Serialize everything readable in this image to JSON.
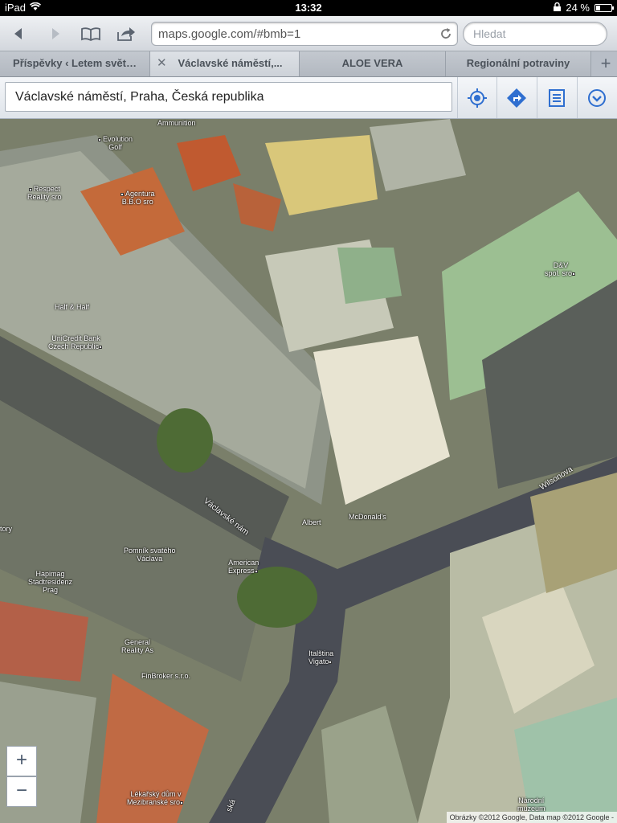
{
  "status_bar": {
    "device": "iPad",
    "time": "13:32",
    "battery": "24 %",
    "battery_level": 0.24,
    "icons": [
      "wifi-icon",
      "lock-icon",
      "battery-icon"
    ]
  },
  "browser": {
    "url": "maps.google.com/#bmb=1",
    "search_placeholder": "Hledat",
    "tabs": [
      {
        "label": "Příspěvky ‹ Letem svět…",
        "active": false
      },
      {
        "label": "Václavské náměstí,...",
        "active": true
      },
      {
        "label": "ALOE VERA",
        "active": false
      },
      {
        "label": "Regionální potraviny",
        "active": false
      }
    ],
    "toolbar_icons": [
      "back-icon",
      "forward-icon",
      "bookmarks-icon",
      "share-icon"
    ]
  },
  "maps": {
    "search_value": "Václavské náměstí, Praha, Česká republika",
    "buttons": [
      "my-location-icon",
      "directions-icon",
      "list-icon",
      "menu-icon"
    ],
    "zoom_in": "+",
    "zoom_out": "−",
    "copyright": "Obrázky ©2012 Google, Data map ©2012 Google -",
    "pois": [
      {
        "label": "Ammunition"
      },
      {
        "label": "Evolution\nGolf"
      },
      {
        "label": "Respect\nReality sro"
      },
      {
        "label": "Agentura\nB.B.O sro"
      },
      {
        "label": "Half & Half"
      },
      {
        "label": "UniCredit Bank\nCzech Republic"
      },
      {
        "label": "D&V\nspol. sro"
      },
      {
        "label": "Albert"
      },
      {
        "label": "McDonald's"
      },
      {
        "label": "Pomník svatého\nVáclava"
      },
      {
        "label": "American\nExpress"
      },
      {
        "label": "Hapimag\nStadtresidenz\nPrag"
      },
      {
        "label": "General\nReality As"
      },
      {
        "label": "FinBroker s.r.o."
      },
      {
        "label": "Italština\nVigato"
      },
      {
        "label": "Lékařský dům v\nMezibranské sro"
      },
      {
        "label": "Národní\nmuzeum"
      },
      {
        "label": "tory"
      }
    ],
    "streets": [
      {
        "label": "Václavské nám"
      },
      {
        "label": "Wilsonova"
      },
      {
        "label": "ská"
      }
    ],
    "colors": {
      "building_roof": "#c8c6b2",
      "orange_roof": "#c46a3a",
      "green_roof": "#8fb08a",
      "road": "#4a4d55",
      "greenery": "#4e6b35"
    }
  }
}
